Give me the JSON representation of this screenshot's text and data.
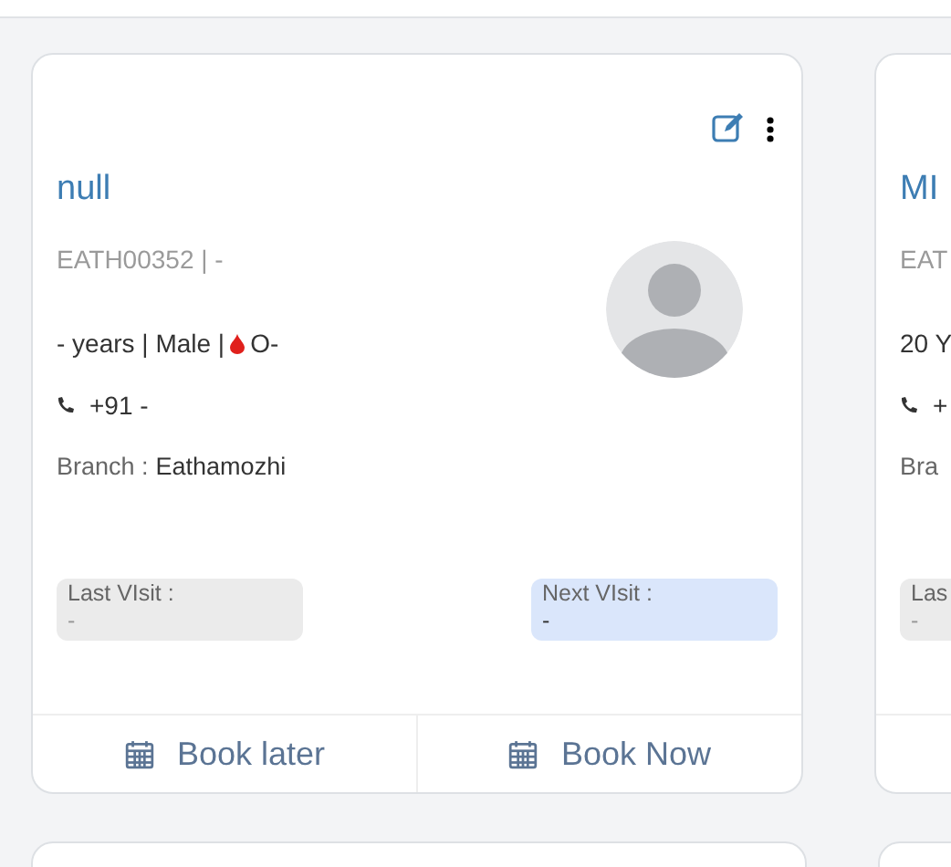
{
  "cards": [
    {
      "name": "null",
      "patient_id": "EATH00352 | -",
      "details": "- years | Male |",
      "blood_group": "O-",
      "phone": "+91 -",
      "branch_label": "Branch :",
      "branch": "Eathamozhi",
      "last_visit": {
        "label": "Last VIsit :",
        "value": "-"
      },
      "next_visit": {
        "label": "Next VIsit :",
        "value": "-"
      },
      "actions": [
        "Book later",
        "Book Now"
      ]
    },
    {
      "name": "MI",
      "patient_id": "EAT",
      "details": "20 Y",
      "phone": "+",
      "branch_label": "Bra",
      "last_visit": {
        "label": "Las",
        "value": "-"
      }
    }
  ]
}
